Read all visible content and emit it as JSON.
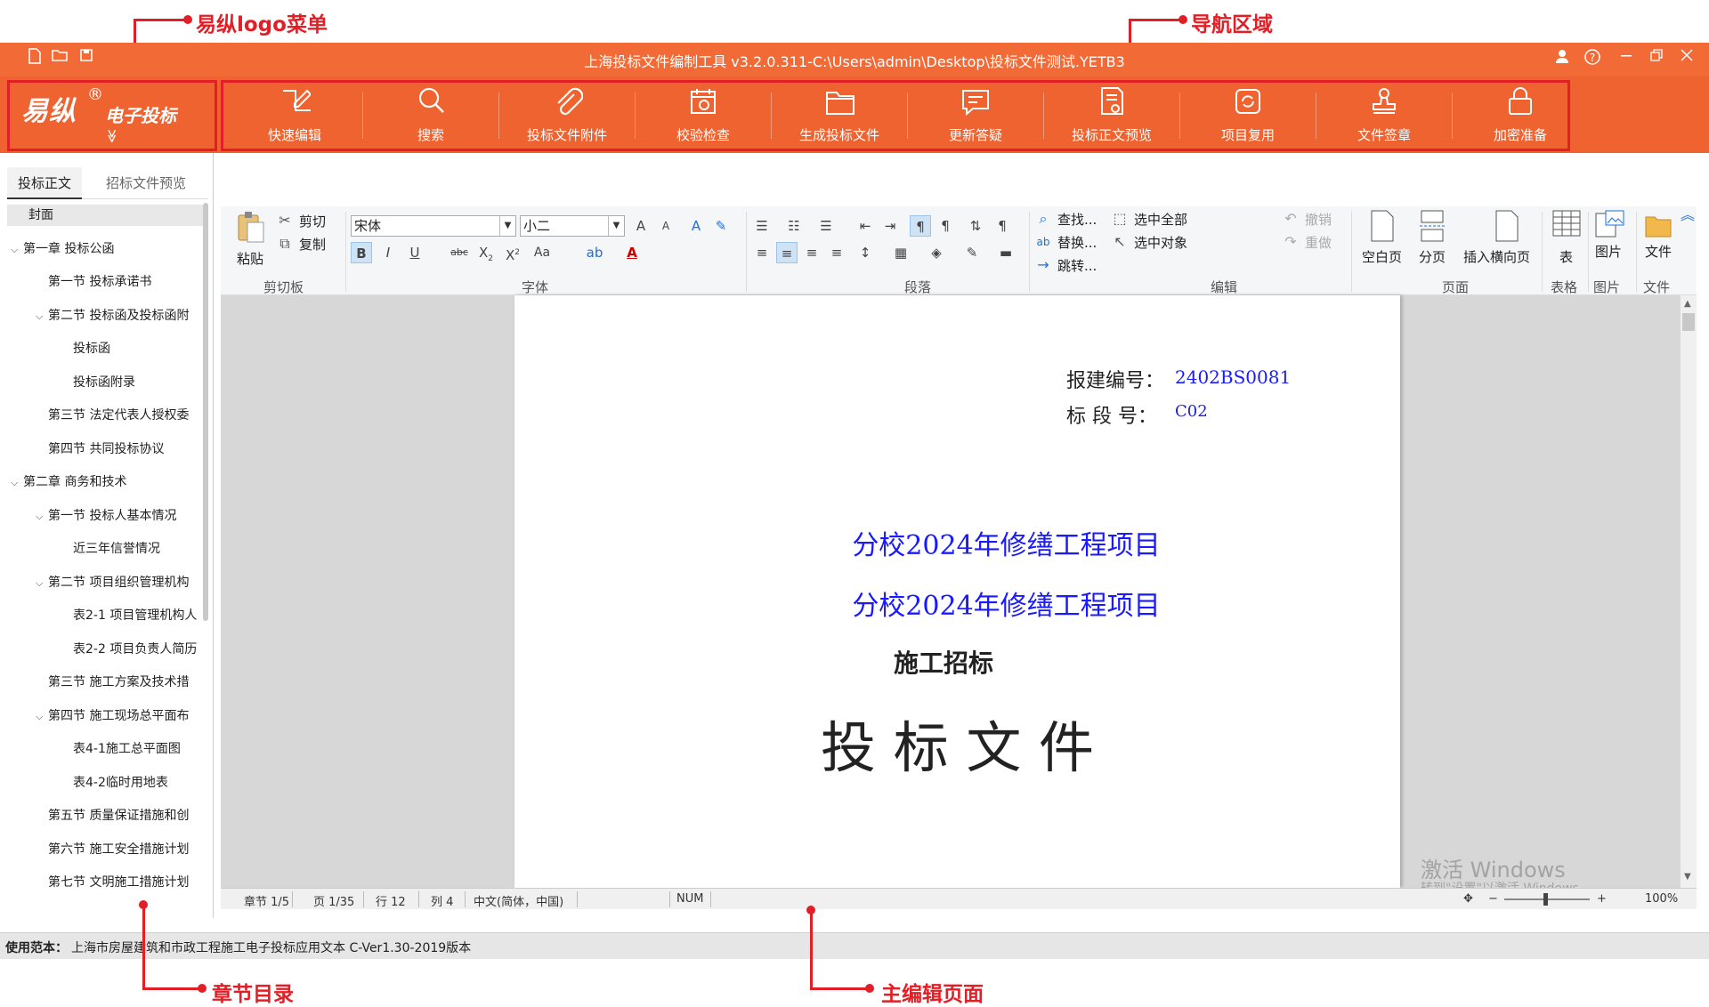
{
  "annotations": {
    "logo_menu": "易纵logo菜单",
    "nav_area": "导航区域",
    "chapter_toc": "章节目录",
    "main_editor": "主编辑页面"
  },
  "window": {
    "title": "上海投标文件编制工具 v3.2.0.311-C:\\Users\\admin\\Desktop\\投标文件测试.YETB3",
    "left_icons": [
      "new-file-icon",
      "open-folder-icon",
      "save-icon"
    ],
    "right_icons": [
      "user-icon",
      "help-icon",
      "minimize-icon",
      "restore-icon",
      "close-icon"
    ]
  },
  "logo": {
    "brand": "易纵",
    "registered": "®",
    "sub": "电子投标",
    "chevron": "≫"
  },
  "nav": {
    "items": [
      {
        "label": "快速编辑",
        "icon": "edit-icon"
      },
      {
        "label": "搜索",
        "icon": "search-icon"
      },
      {
        "label": "投标文件附件",
        "icon": "paperclip-icon"
      },
      {
        "label": "校验检查",
        "icon": "calendar-check-icon"
      },
      {
        "label": "生成投标文件",
        "icon": "folder-icon"
      },
      {
        "label": "更新答疑",
        "icon": "chat-icon"
      },
      {
        "label": "投标正文预览",
        "icon": "document-preview-icon"
      },
      {
        "label": "项目复用",
        "icon": "reuse-icon"
      },
      {
        "label": "文件签章",
        "icon": "stamp-icon"
      },
      {
        "label": "加密准备",
        "icon": "lock-icon"
      }
    ]
  },
  "sidebar": {
    "tabs": [
      "投标正文",
      "招标文件预览"
    ],
    "tree": [
      {
        "label": "封面",
        "level": 0,
        "caret": ""
      },
      {
        "label": "第一章 投标公函",
        "level": 0,
        "caret": "v"
      },
      {
        "label": "第一节 投标承诺书",
        "level": 1,
        "caret": ""
      },
      {
        "label": "第二节 投标函及投标函附",
        "level": 1,
        "caret": "v"
      },
      {
        "label": "投标函",
        "level": 2,
        "caret": ""
      },
      {
        "label": "投标函附录",
        "level": 2,
        "caret": ""
      },
      {
        "label": "第三节 法定代表人授权委",
        "level": 1,
        "caret": ""
      },
      {
        "label": "第四节 共同投标协议",
        "level": 1,
        "caret": ""
      },
      {
        "label": "第二章 商务和技术",
        "level": 0,
        "caret": "v"
      },
      {
        "label": "第一节 投标人基本情况",
        "level": 1,
        "caret": "v"
      },
      {
        "label": "近三年信誉情况",
        "level": 2,
        "caret": ""
      },
      {
        "label": "第二节 项目组织管理机构",
        "level": 1,
        "caret": "v"
      },
      {
        "label": "表2-1 项目管理机构人",
        "level": 2,
        "caret": ""
      },
      {
        "label": "表2-2 项目负责人简历",
        "level": 2,
        "caret": ""
      },
      {
        "label": "第三节 施工方案及技术措",
        "level": 1,
        "caret": ""
      },
      {
        "label": "第四节 施工现场总平面布",
        "level": 1,
        "caret": "v"
      },
      {
        "label": "表4-1施工总平面图",
        "level": 2,
        "caret": ""
      },
      {
        "label": "表4-2临时用地表",
        "level": 2,
        "caret": ""
      },
      {
        "label": "第五节 质量保证措施和创",
        "level": 1,
        "caret": ""
      },
      {
        "label": "第六节 施工安全措施计划",
        "level": 1,
        "caret": ""
      },
      {
        "label": "第七节 文明施工措施计划",
        "level": 1,
        "caret": ""
      }
    ]
  },
  "ribbon": {
    "clipboard": {
      "paste": "粘贴",
      "cut": "剪切",
      "copy": "复制",
      "group": "剪切板"
    },
    "font": {
      "family": "宋体",
      "size": "小二",
      "case_btn": "Aa",
      "strike_btn": "abc",
      "group": "字体"
    },
    "paragraph": {
      "group": "段落"
    },
    "edit": {
      "find": "查找...",
      "replace": "替换...",
      "goto": "跳转...",
      "select_all": "选中全部",
      "select_obj": "选中对象",
      "undo": "撤销",
      "redo": "重做",
      "group": "编辑"
    },
    "page": {
      "blank": "空白页",
      "break": "分页",
      "landscape": "插入横向页",
      "group": "页面"
    },
    "table": {
      "label": "表",
      "group": "表格"
    },
    "picture": {
      "label": "图片",
      "group": "图片"
    },
    "file": {
      "label": "文件",
      "group": "文件"
    }
  },
  "document": {
    "report_no_label": "报建编号：",
    "report_no_value": "2402BS0081",
    "section_label": "标 段 号：",
    "section_value": "C02",
    "project_1": "分校2024年修缮工程项目",
    "project_2": "分校2024年修缮工程项目",
    "subtitle": "施工招标",
    "main_title": "投 标 文 件"
  },
  "status": {
    "chapter": "章节 1/5",
    "page": "页 1/35",
    "row": "行 12",
    "col": "列 4",
    "lang": "中文(简体，中国)",
    "num": "NUM",
    "zoom": "100%",
    "watermark_1": "激活 Windows",
    "watermark_2": "转到\"设置\"以激活 Windows。"
  },
  "footer": {
    "label": "使用范本：",
    "text": "上海市房屋建筑和市政工程施工电子投标应用文本  C-Ver1.30-2019版本"
  },
  "colors": {
    "brand_orange": "#f26a35",
    "annotation_red": "#e21f26",
    "doc_blue": "#1a1aff"
  }
}
